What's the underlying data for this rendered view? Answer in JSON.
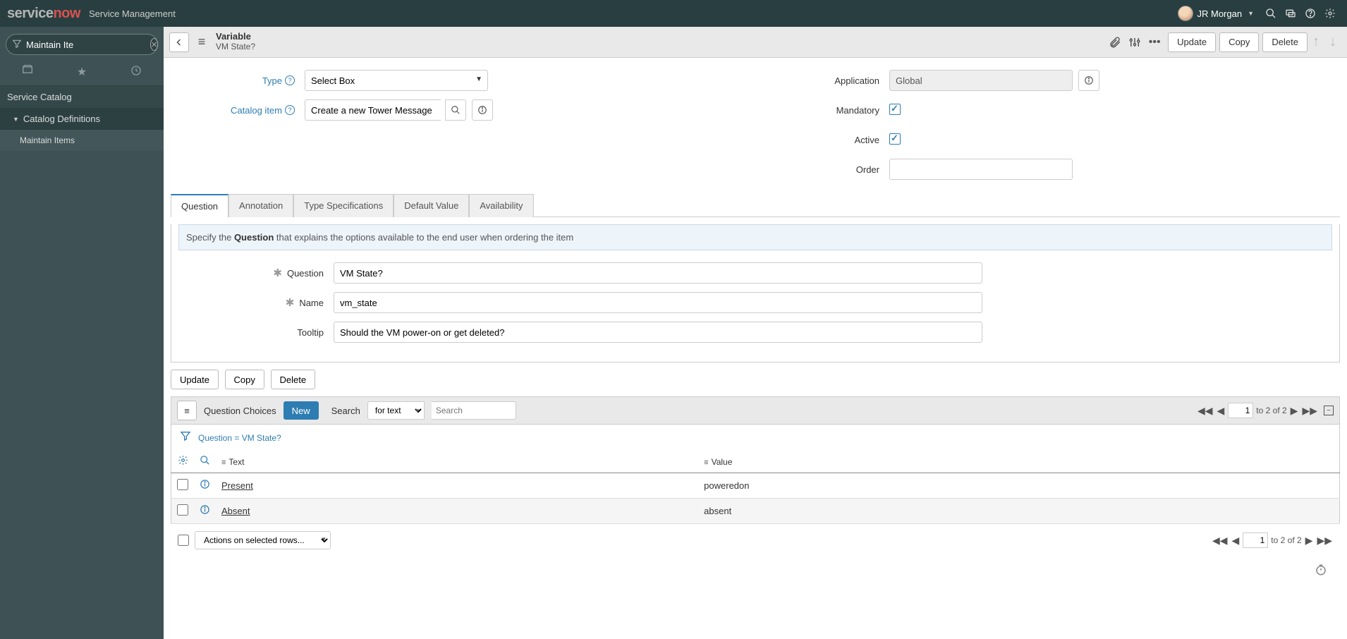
{
  "banner": {
    "logo_text_1": "service",
    "logo_text_2": "now",
    "sub": "Service Management",
    "user": "JR Morgan"
  },
  "sidebar": {
    "filter_value": "Maintain Ite",
    "section": "Service Catalog",
    "sub": "Catalog Definitions",
    "leaf": "Maintain Items"
  },
  "header": {
    "title": "Variable",
    "subtitle": "VM State?",
    "update": "Update",
    "copy": "Copy",
    "delete": "Delete"
  },
  "form": {
    "type_label": "Type",
    "type_value": "Select Box",
    "catalog_label": "Catalog item",
    "catalog_value": "Create a new Tower Message",
    "application_label": "Application",
    "application_value": "Global",
    "mandatory_label": "Mandatory",
    "active_label": "Active",
    "order_label": "Order",
    "order_value": ""
  },
  "tabs": {
    "t0": "Question",
    "t1": "Annotation",
    "t2": "Type Specifications",
    "t3": "Default Value",
    "t4": "Availability",
    "hint_pre": "Specify the ",
    "hint_b": "Question",
    "hint_post": " that explains the options available to the end user when ordering the item",
    "question_label": "Question",
    "question_value": "VM State?",
    "name_label": "Name",
    "name_value": "vm_state",
    "tooltip_label": "Tooltip",
    "tooltip_value": "Should the VM power-on or get deleted?"
  },
  "lower": {
    "update": "Update",
    "copy": "Copy",
    "delete": "Delete"
  },
  "rel": {
    "title": "Question Choices",
    "new": "New",
    "search_label": "Search",
    "search_sel": "for text",
    "search_placeholder": "Search",
    "crumb": "Question = VM State?",
    "col_text": "Text",
    "col_value": "Value",
    "rows": [
      {
        "text": "Present",
        "value": "poweredon"
      },
      {
        "text": "Absent",
        "value": "absent"
      }
    ],
    "actions": "Actions on selected rows...",
    "page": "1",
    "page_to": "to 2 of 2",
    "page2": "1",
    "page2_to": "to 2 of 2"
  }
}
